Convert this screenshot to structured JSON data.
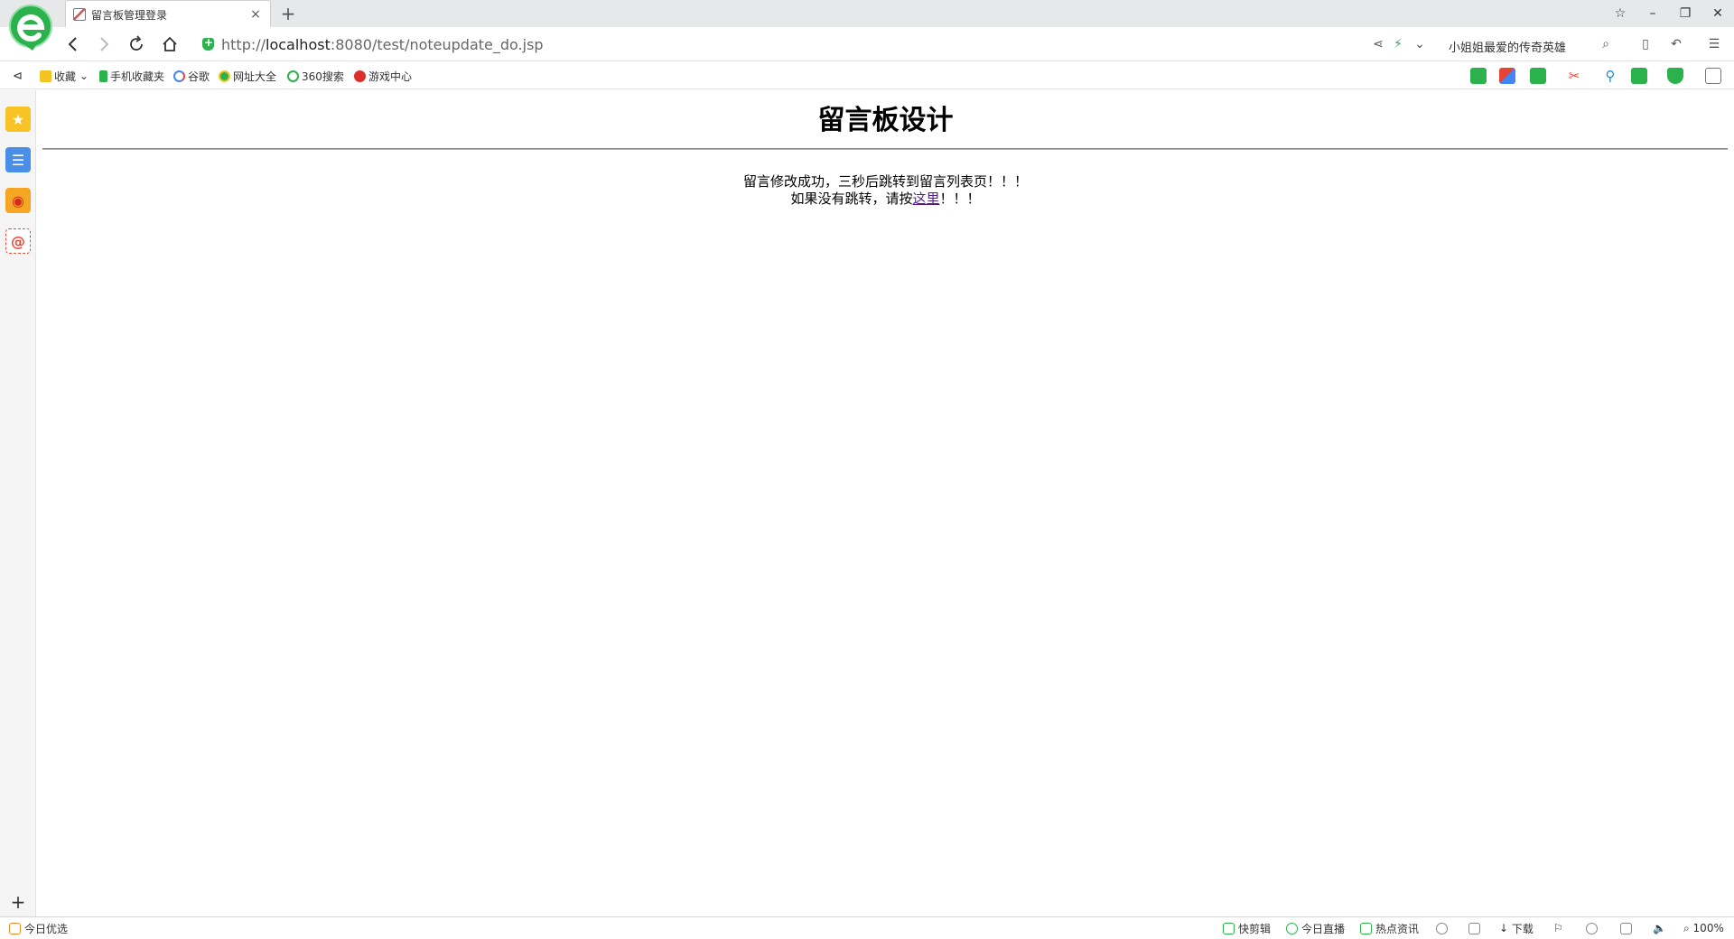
{
  "browser": {
    "tab": {
      "title": "留言板管理登录"
    },
    "new_tab_label": "+",
    "window_controls": {
      "skin": "☆",
      "minimize": "–",
      "restore": "❐",
      "close": "✕"
    },
    "url": {
      "scheme": "http://",
      "host": "localhost",
      "rest": ":8080/test/noteupdate_do.jsp"
    },
    "search_text": "小姐姐最爱的传奇英雄"
  },
  "bookmarks": [
    {
      "label": "收藏",
      "icon": "star-icon"
    },
    {
      "label": "手机收藏夹",
      "icon": "phone-icon"
    },
    {
      "label": "谷歌",
      "icon": "google-icon"
    },
    {
      "label": "网址大全",
      "icon": "compass-icon"
    },
    {
      "label": "360搜索",
      "icon": "360-icon"
    },
    {
      "label": "游戏中心",
      "icon": "game-icon"
    }
  ],
  "page": {
    "title": "留言板设计",
    "message_line1": "留言修改成功，三秒后跳转到留言列表页！！！",
    "message_line2_prefix": "如果没有跳转，请按",
    "link_text": "这里",
    "message_line2_suffix": "！！！"
  },
  "statusbar": {
    "today_pick": "今日优选",
    "quick_cut": "快剪辑",
    "live_today": "今日直播",
    "hot_news": "热点资讯",
    "download": "下载",
    "zoom": "100%"
  },
  "colors": {
    "accent": "#2bb24c",
    "link_visited": "#551a8b"
  }
}
